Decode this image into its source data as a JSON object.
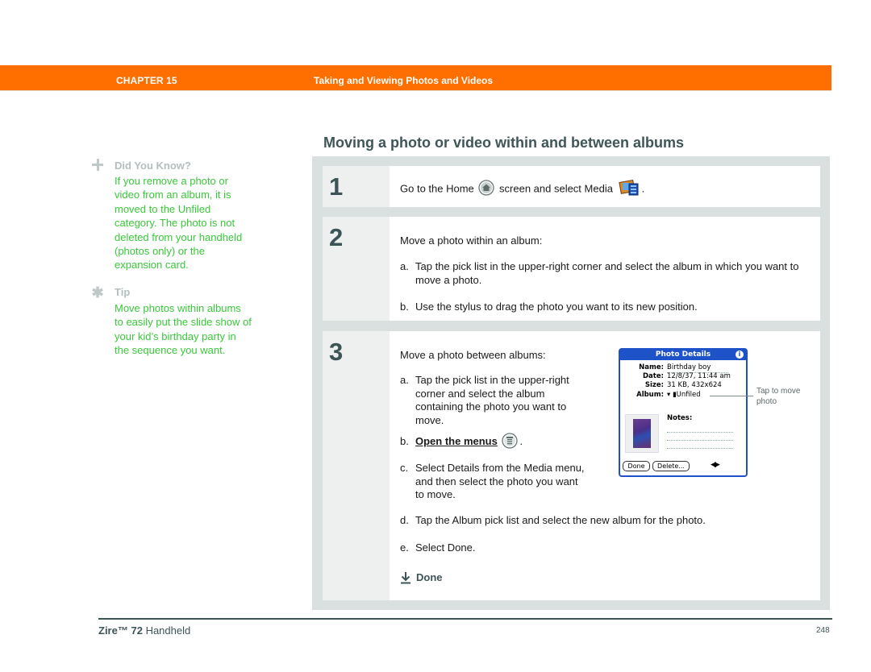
{
  "header": {
    "chapter_label": "CHAPTER 15",
    "chapter_title": "Taking and Viewing Photos and Videos",
    "color": "#ff6f00"
  },
  "sidebar": {
    "did_you_know": {
      "icon": "plus-icon",
      "title": "Did You Know?",
      "text": "If you remove a photo or video from an album, it is moved to the Unfiled category. The photo is not deleted from your handheld (photos only) or the expansion card."
    },
    "tip": {
      "icon": "asterisk-icon",
      "icon_glyph": "✱",
      "title": "Tip",
      "text": "Move photos within albums to easily put the slide show of your kid’s birthday party in the sequence you want."
    },
    "text_color": "#3ac83a"
  },
  "section": {
    "title": "Moving a photo or video within and between albums"
  },
  "steps": [
    {
      "number": "1",
      "text_before": "Go to the Home",
      "home_icon": "home-icon",
      "text_middle": "screen and select Media",
      "media_icon": "media-icon",
      "text_after": "."
    },
    {
      "number": "2",
      "intro": "Move a photo within an album:",
      "substeps": [
        {
          "label": "a.",
          "text": "Tap the pick list in the upper-right corner and select the album in which you want to move a photo."
        },
        {
          "label": "b.",
          "text": "Use the stylus to drag the photo you want to its new position."
        }
      ]
    },
    {
      "number": "3",
      "intro": "Move a photo between albums:",
      "substeps": [
        {
          "label": "a.",
          "text": "Tap the pick list in the upper-right corner and select the album containing the photo you want to move."
        },
        {
          "label": "b.",
          "link": "Open the menus",
          "icon": "menu-icon",
          "after": "."
        },
        {
          "label": "c.",
          "text": "Select Details from the Media menu, and then select the photo you want to move."
        },
        {
          "label": "d.",
          "text": "Tap the Album pick list and select the new album for the photo."
        },
        {
          "label": "e.",
          "text": "Select Done."
        }
      ],
      "done_label": "Done"
    }
  ],
  "palm_screen": {
    "title": "Photo Details",
    "info_icon": "i",
    "fields": [
      {
        "key": "Name:",
        "value": "Birthday boy"
      },
      {
        "key": "Date:",
        "value": "12/8/37, 11:44 am"
      },
      {
        "key": "Size:",
        "value": "31 KB, 432x624"
      },
      {
        "key": "Album:",
        "value": "▾ ▮Unfiled"
      }
    ],
    "notes_label": "Notes:",
    "buttons": [
      "Done",
      "Delete..."
    ],
    "nav_arrows": "◀▶",
    "callout": "Tap to move photo"
  },
  "footer": {
    "product_prefix": "Zire™",
    "product_model": "72",
    "product_suffix": "Handheld",
    "page_number": "248"
  }
}
